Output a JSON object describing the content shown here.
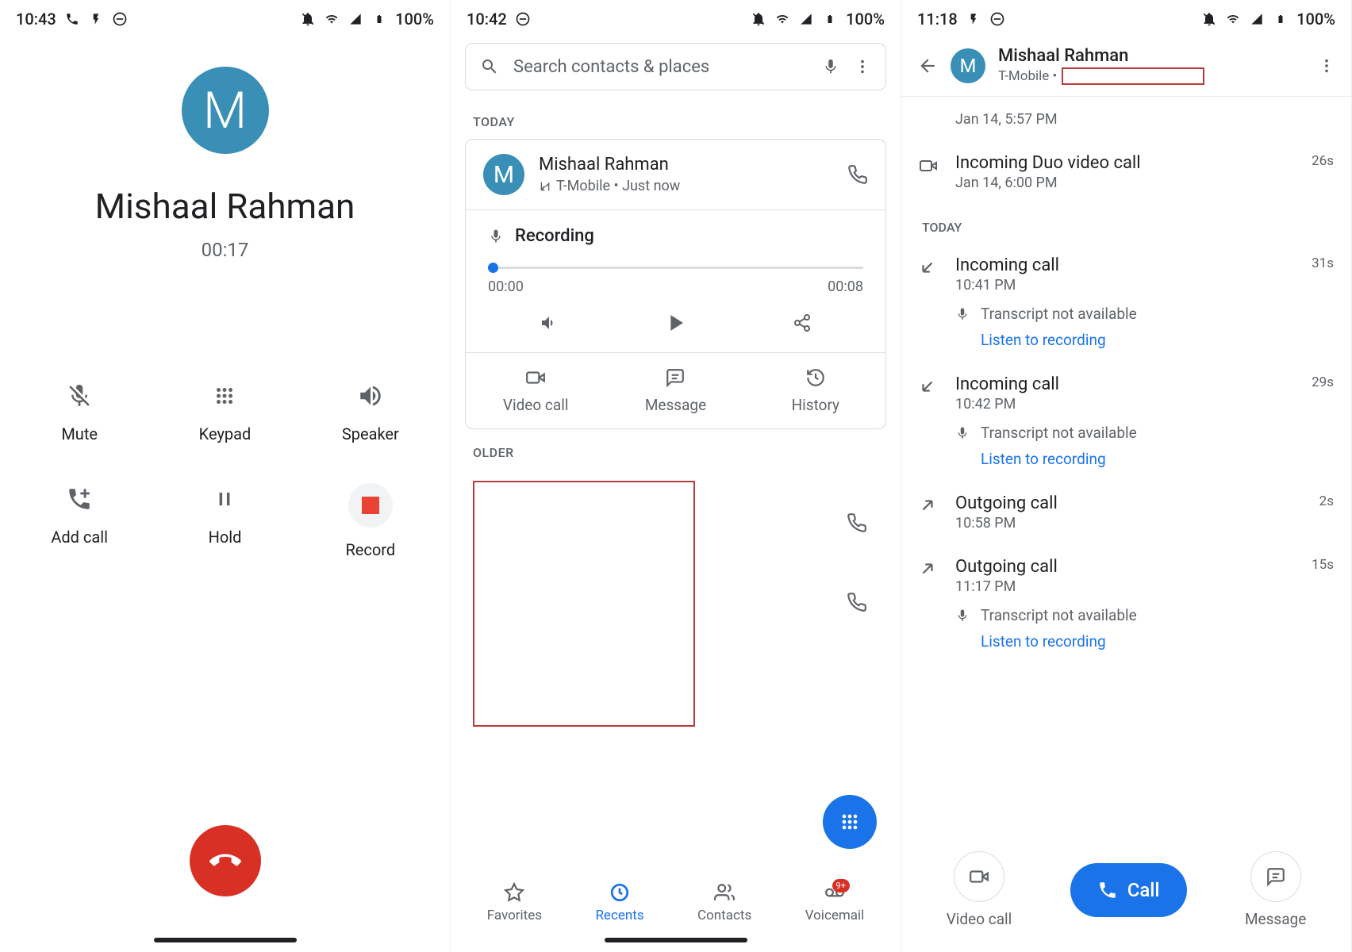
{
  "status": {
    "p1": {
      "time": "10:43",
      "battery": "100%"
    },
    "p2": {
      "time": "10:42",
      "battery": "100%"
    },
    "p3": {
      "time": "11:18",
      "battery": "100%"
    }
  },
  "call_screen": {
    "avatar_letter": "M",
    "name": "Mishaal Rahman",
    "timer": "00:17",
    "buttons": {
      "mute": "Mute",
      "keypad": "Keypad",
      "speaker": "Speaker",
      "add_call": "Add call",
      "hold": "Hold",
      "record": "Record"
    }
  },
  "recents": {
    "search_placeholder": "Search contacts & places",
    "today_label": "TODAY",
    "older_label": "OLDER",
    "entry": {
      "avatar_letter": "M",
      "name": "Mishaal Rahman",
      "sub": "T-Mobile • Just now"
    },
    "recording": {
      "label": "Recording",
      "start": "00:00",
      "end": "00:08"
    },
    "actions": {
      "video": "Video call",
      "message": "Message",
      "history": "History"
    },
    "tabs": {
      "favorites": "Favorites",
      "recents": "Recents",
      "contacts": "Contacts",
      "voicemail": "Voicemail",
      "badge": "9+"
    }
  },
  "detail": {
    "name": "Mishaal Rahman",
    "carrier": "T-Mobile •",
    "avatar_letter": "M",
    "today_label": "TODAY",
    "entries": [
      {
        "type": "time_only",
        "time": "Jan 14, 5:57 PM"
      },
      {
        "type": "duo",
        "title": "Incoming Duo video call",
        "time": "Jan 14, 6:00 PM",
        "dur": "26s"
      },
      {
        "type": "in",
        "title": "Incoming call",
        "time": "10:41 PM",
        "dur": "31s",
        "transcript": "Transcript not available",
        "listen": "Listen to recording"
      },
      {
        "type": "in",
        "title": "Incoming call",
        "time": "10:42 PM",
        "dur": "29s",
        "transcript": "Transcript not available",
        "listen": "Listen to recording"
      },
      {
        "type": "out",
        "title": "Outgoing call",
        "time": "10:58 PM",
        "dur": "2s"
      },
      {
        "type": "out",
        "title": "Outgoing call",
        "time": "11:17 PM",
        "dur": "15s",
        "transcript": "Transcript not available",
        "listen": "Listen to recording"
      }
    ],
    "bottom": {
      "video": "Video call",
      "call": "Call",
      "message": "Message"
    }
  }
}
